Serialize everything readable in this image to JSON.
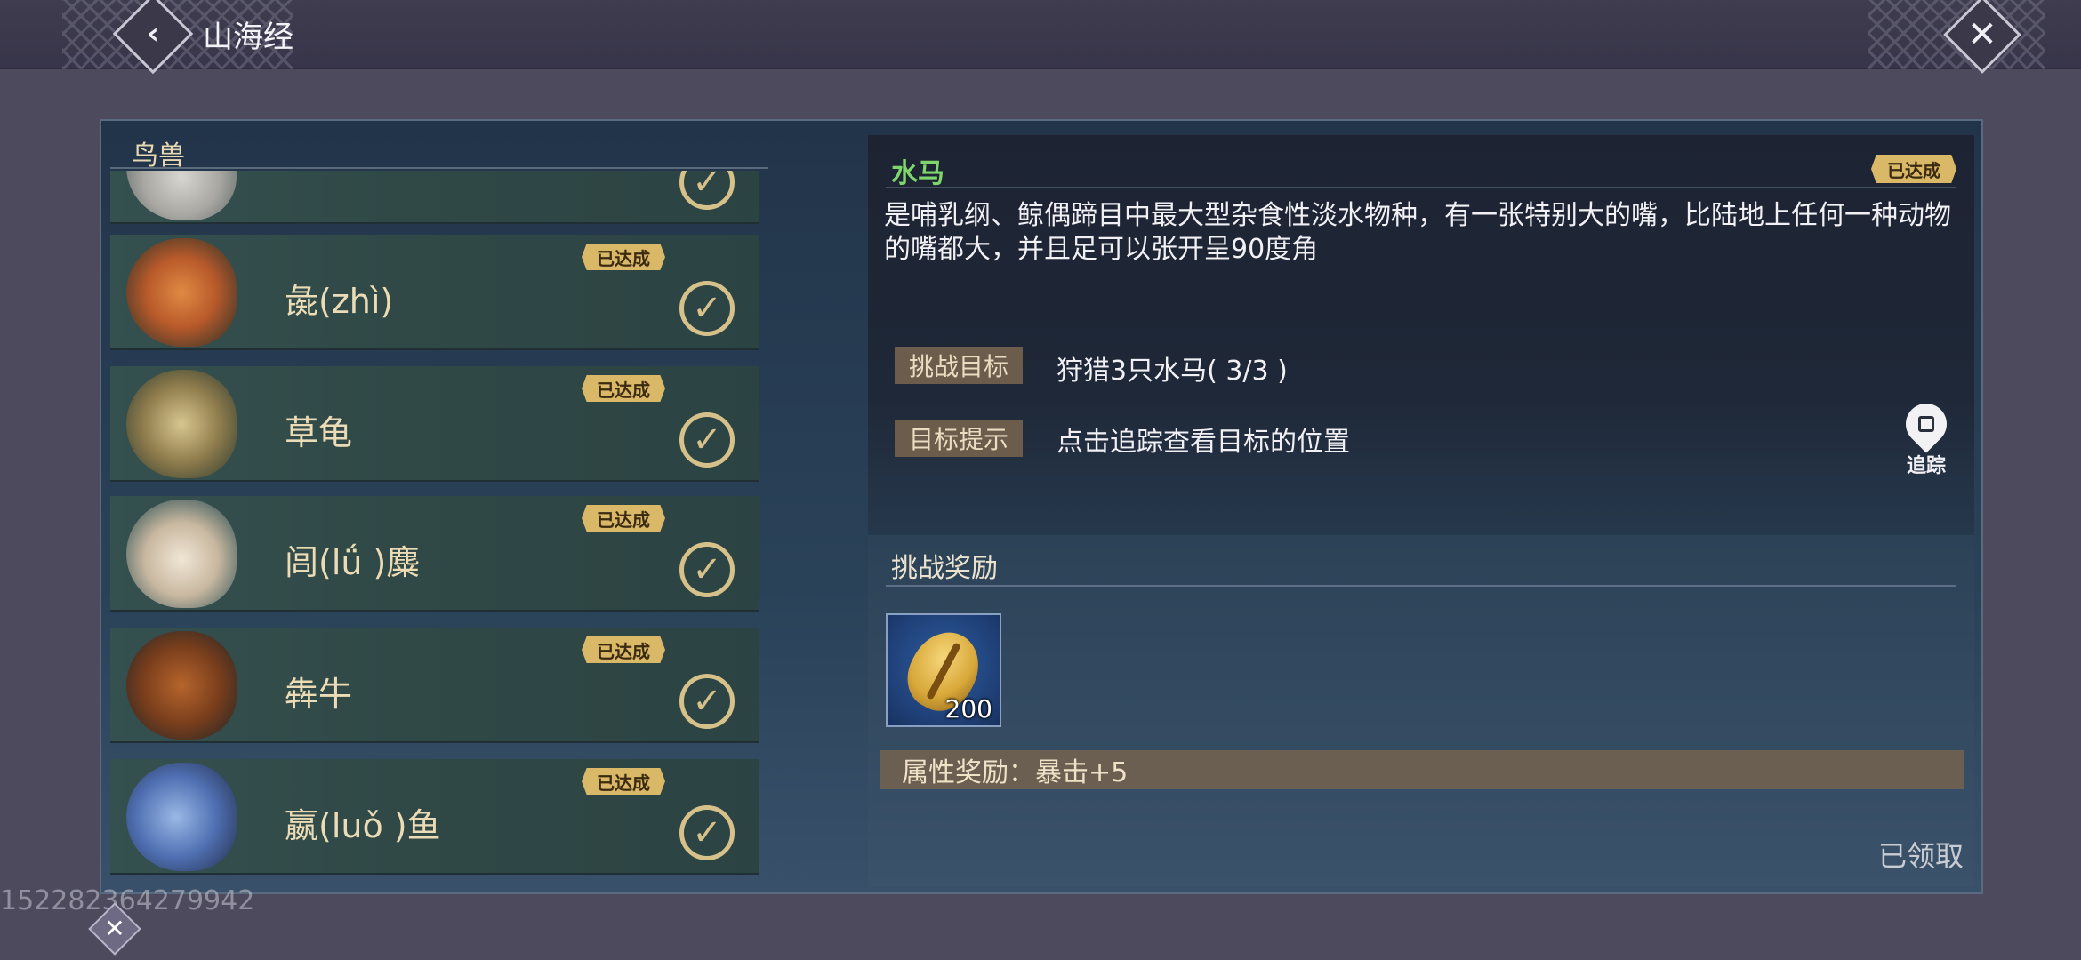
{
  "header": {
    "title": "山海经",
    "back_icon": "chevron-left-icon",
    "close_icon": "close-icon"
  },
  "category": {
    "title": "鸟兽"
  },
  "creatures": [
    {
      "name": "",
      "badge": "",
      "completed": true,
      "partial": true
    },
    {
      "name": "彘(zhì)",
      "badge": "已达成",
      "completed": true
    },
    {
      "name": "草龟",
      "badge": "已达成",
      "completed": true
    },
    {
      "name": "闾(lǘ )麋",
      "badge": "已达成",
      "completed": true
    },
    {
      "name": "犇牛",
      "badge": "已达成",
      "completed": true
    },
    {
      "name": "嬴(luǒ )鱼",
      "badge": "已达成",
      "completed": true
    }
  ],
  "detail": {
    "name": "水马",
    "badge": "已达成",
    "description": "是哺乳纲、鲸偶蹄目中最大型杂食性淡水物种，有一张特别大的嘴，比陆地上任何一种动物的嘴都大，并且足可以张开呈90度角",
    "challenge_label": "挑战目标",
    "challenge_value": "狩猎3只水马( 3/3 )",
    "hint_label": "目标提示",
    "hint_value": "点击追踪查看目标的位置",
    "track_label": "追踪"
  },
  "reward": {
    "title": "挑战奖励",
    "item_quantity": "200",
    "attribute": "属性奖励：暴击+5",
    "status": "已领取"
  },
  "watermark": "152282364279942",
  "colors": {
    "badge": "#d9b867",
    "name_green": "#7fd66b",
    "label_brown": "#6b5c4b"
  }
}
